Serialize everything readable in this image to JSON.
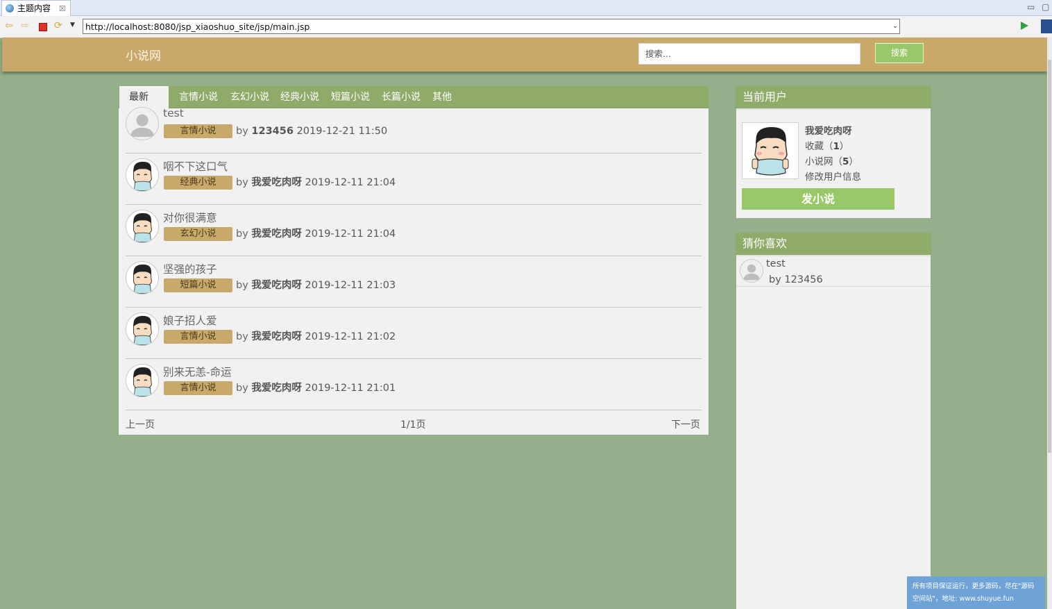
{
  "ide_tab": {
    "title": "主题内容",
    "close": "☒"
  },
  "browser": {
    "url": "http://localhost:8080/jsp_xiaoshuo_site/jsp/main.jsp"
  },
  "site": {
    "title": "小说网",
    "search_placeholder": "搜索...",
    "search_button": "搜索"
  },
  "category_tabs": [
    "最新",
    "言情小说",
    "玄幻小说",
    "经典小说",
    "短篇小说",
    "长篇小说",
    "其他"
  ],
  "posts": [
    {
      "title": "test",
      "tag": "言情小说",
      "by": "by",
      "author": "123456",
      "time": "2019-12-21 11:50",
      "avatar": "default"
    },
    {
      "title": "咽不下这口气",
      "tag": "经典小说",
      "by": "by",
      "author": "我爱吃肉呀",
      "time": "2019-12-11 21:04",
      "avatar": "cartoon"
    },
    {
      "title": "对你很满意",
      "tag": "玄幻小说",
      "by": "by",
      "author": "我爱吃肉呀",
      "time": "2019-12-11 21:04",
      "avatar": "cartoon"
    },
    {
      "title": "坚强的孩子",
      "tag": "短篇小说",
      "by": "by",
      "author": "我爱吃肉呀",
      "time": "2019-12-11 21:03",
      "avatar": "cartoon"
    },
    {
      "title": "娘子招人爱",
      "tag": "言情小说",
      "by": "by",
      "author": "我爱吃肉呀",
      "time": "2019-12-11 21:02",
      "avatar": "cartoon"
    },
    {
      "title": "别来无恙-命运",
      "tag": "言情小说",
      "by": "by",
      "author": "我爱吃肉呀",
      "time": "2019-12-11 21:01",
      "avatar": "cartoon"
    }
  ],
  "pager": {
    "prev": "上一页",
    "current": "1/1页",
    "next": "下一页"
  },
  "current_user": {
    "heading": "当前用户",
    "name": "我爱吃肉呀",
    "favorites_label": "收藏（",
    "favorites_count": "1",
    "novels_label": "小说网（",
    "novels_count": "5",
    "close_paren": "）",
    "edit_link": "修改用户信息",
    "post_button": "发小说"
  },
  "recommend": {
    "heading": "猜你喜欢",
    "items": [
      {
        "title": "test",
        "by": "by 123456"
      }
    ]
  },
  "ad": {
    "line1": "所有项目保证运行，更多源码，尽在\"源码",
    "line2": "空间站\"，地址: www.shuyue.fun"
  },
  "colors": {
    "page_bg": "#93b08a",
    "header_bg": "#c8a96a",
    "tab_bar": "#8fab6a",
    "button_green": "#99c868",
    "tag_bg": "#c8a96a"
  }
}
